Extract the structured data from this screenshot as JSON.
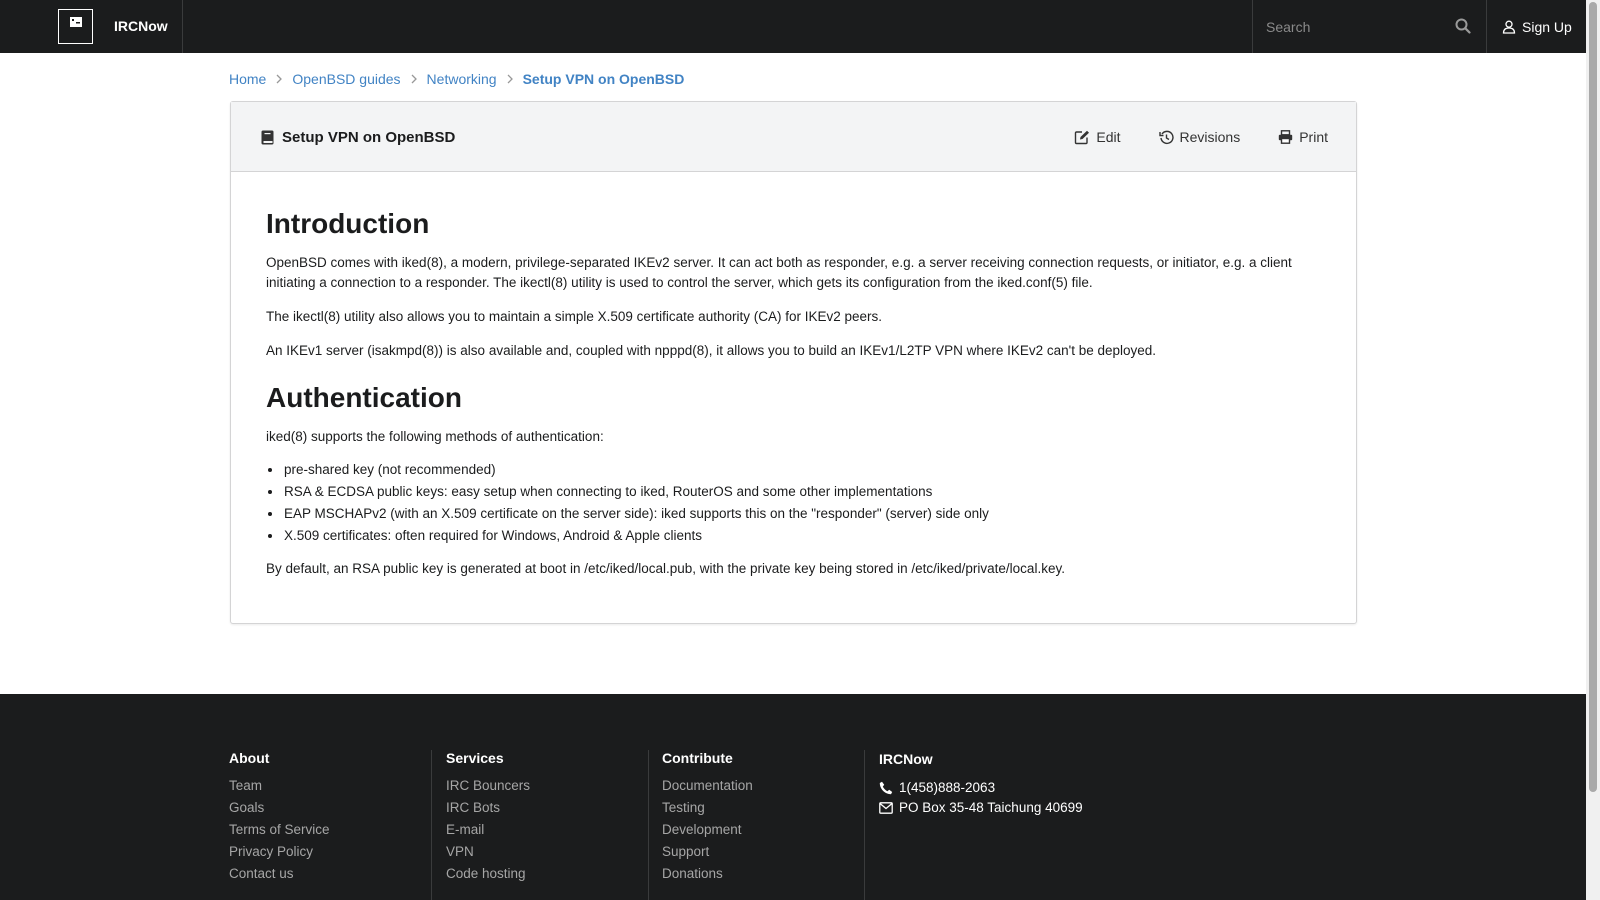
{
  "nav": {
    "brand": "IRCNow",
    "search_placeholder": "Search",
    "signup_label": "Sign Up"
  },
  "breadcrumb": [
    {
      "label": "Home"
    },
    {
      "label": "OpenBSD guides"
    },
    {
      "label": "Networking"
    },
    {
      "label": "Setup VPN on OpenBSD"
    }
  ],
  "article": {
    "title": "Setup VPN on OpenBSD",
    "actions": {
      "edit": "Edit",
      "revisions": "Revisions",
      "print": "Print"
    },
    "intro_heading": "Introduction",
    "intro_p1": "OpenBSD comes with iked(8), a modern, privilege-separated IKEv2 server. It can act both as responder, e.g. a server receiving connection requests, or initiator, e.g. a client initiating a connection to a responder. The ikectl(8) utility is used to control the server, which gets its configuration from the iked.conf(5) file.",
    "intro_p2": "The ikectl(8) utility also allows you to maintain a simple X.509 certificate authority (CA) for IKEv2 peers.",
    "intro_p3": "An IKEv1 server (isakmpd(8)) is also available and, coupled with npppd(8), it allows you to build an IKEv1/L2TP VPN where IKEv2 can't be deployed.",
    "auth_heading": "Authentication",
    "auth_p1": "iked(8) supports the following methods of authentication:",
    "auth_list": [
      "pre-shared key (not recommended)",
      "RSA & ECDSA public keys: easy setup when connecting to iked, RouterOS and some other implementations",
      "EAP MSCHAPv2 (with an X.509 certificate on the server side): iked supports this on the \"responder\" (server) side only",
      "X.509 certificates: often required for Windows, Android & Apple clients"
    ],
    "auth_p2": "By default, an RSA public key is generated at boot in /etc/iked/local.pub, with the private key being stored in /etc/iked/private/local.key."
  },
  "footer": {
    "about": {
      "heading": "About",
      "links": [
        "Team",
        "Goals",
        "Terms of Service",
        "Privacy Policy",
        "Contact us"
      ]
    },
    "services": {
      "heading": "Services",
      "links": [
        "IRC Bouncers",
        "IRC Bots",
        "E-mail",
        "VPN",
        "Code hosting"
      ]
    },
    "contribute": {
      "heading": "Contribute",
      "links": [
        "Documentation",
        "Testing",
        "Development",
        "Support",
        "Donations"
      ]
    },
    "contact": {
      "heading": "IRCNow",
      "phone": "1(458)888-2063",
      "address": "PO Box 35-48 Taichung 40699"
    }
  },
  "colors": {
    "nav_bg": "#1b1c1d",
    "link": "#4183c4",
    "card_head_bg": "#f3f4f5"
  }
}
